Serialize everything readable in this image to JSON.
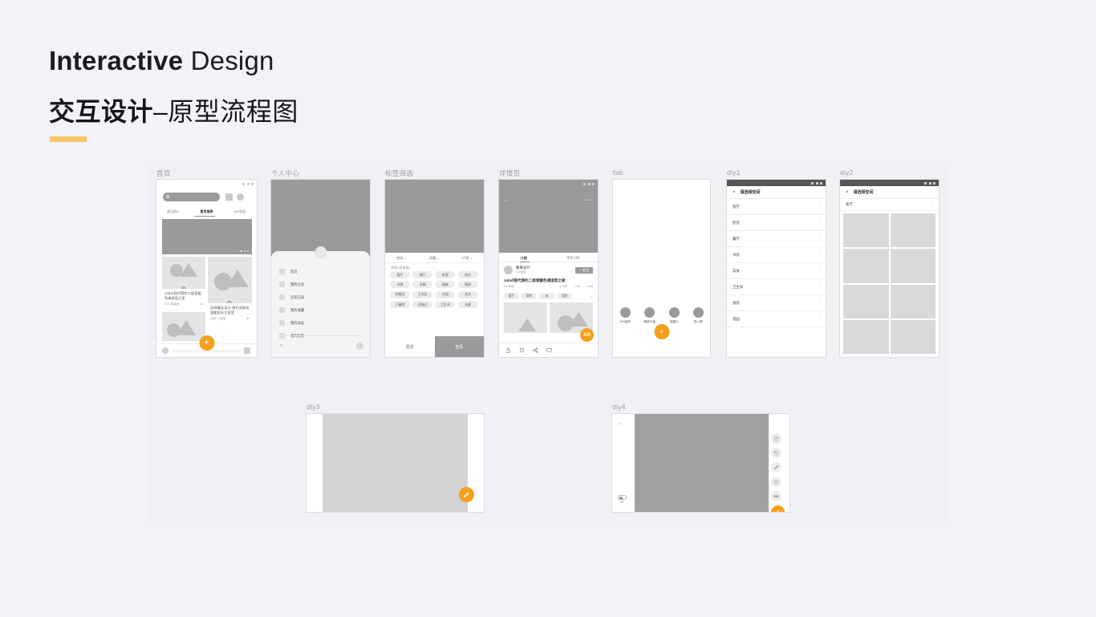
{
  "title": {
    "en_bold": "Interactive",
    "en_rest": " Design",
    "cn_bold": "交互设计",
    "cn_rest": "–原型流程图"
  },
  "colors": {
    "background": "#f2f3f7",
    "panel": "#f0f1f5",
    "accent": "#f5a01c",
    "rule": "#f9c56a",
    "placeholder": "#9a9a9a",
    "placeholder_light": "#d6d6d6"
  },
  "screens": {
    "home": {
      "label": "首页",
      "search_placeholder": "",
      "tabs": [
        "关注的人",
        "首页推荐",
        "DIY社区"
      ],
      "active_tab": "首页推荐",
      "cards": [
        {
          "title": "140㎡现代简约二居室暖色调造型之家",
          "meta_left": "DIY–家装室",
          "meta_right": "14"
        },
        {
          "title": "深圳臻品设计·简约北欧风温暖阳光三居室",
          "meta_left": "北欧·三居室",
          "meta_right": "89"
        }
      ],
      "fab": "+"
    },
    "profile": {
      "label": "个人中心",
      "menu": [
        "首页",
        "我的信息",
        "历史记录",
        "我的收藏",
        "我的动态",
        "我的标签"
      ],
      "collapse_icon": "chevron-down"
    },
    "filter": {
      "label": "标签筛选",
      "selectors": [
        "空间",
        "风格",
        "户型"
      ],
      "group_title": "空间 (可多选)",
      "tags": [
        "客厅",
        "餐厅",
        "卧室",
        "阳台",
        "书房",
        "衣橱",
        "楼梯",
        "厨房",
        "衣帽间",
        "工作区",
        "花园",
        "玄关",
        "儿童房",
        "开放式",
        "卫生间",
        "走廊"
      ],
      "reset_label": "重置",
      "confirm_label": "查看"
    },
    "detail": {
      "label": "详情页",
      "tabs": [
        "介绍",
        "评论"
      ],
      "active_tab": "介绍",
      "comment_count": "188",
      "author": "暖果设计",
      "author_sub": "100粉丝",
      "follow_label": "+ 关注",
      "title": "140㎡现代简约二居室暖色调造型之家",
      "time": "2小时前",
      "stats": [
        {
          "icon": "eye-icon",
          "value": "658"
        },
        {
          "icon": "thumb-icon",
          "value": "166"
        },
        {
          "icon": "heart-icon",
          "value": "668"
        }
      ],
      "tags": [
        "客厅",
        "简约",
        "床",
        "北欧"
      ],
      "ar_label": "AR",
      "actions": [
        "thumb-up-icon",
        "heart-icon",
        "share-icon",
        "comment-icon"
      ]
    },
    "fab": {
      "label": "fab",
      "items": [
        "DIY装饰",
        "精选方案",
        "发图片",
        "发心得"
      ],
      "close_label": "×"
    },
    "diy1": {
      "label": "diy1",
      "header_title": "请选择空间",
      "close_icon": "×",
      "items": [
        "客厅",
        "卧室",
        "餐厅",
        "书房",
        "玄关",
        "卫生间",
        "厨房",
        "花园"
      ]
    },
    "diy2": {
      "label": "diy2",
      "header_title": "请选择空间",
      "close_icon": "×",
      "selected": "客厅",
      "grid_count": 8
    },
    "diy3": {
      "label": "diy3",
      "fab_icon": "pencil-icon"
    },
    "diy4": {
      "label": "diy4",
      "ar_toggle_label": "AR",
      "tools": [
        "undo-icon",
        "redo-icon",
        "pencil-icon",
        "fill-icon",
        "eraser-icon"
      ],
      "close_label": "×"
    }
  }
}
